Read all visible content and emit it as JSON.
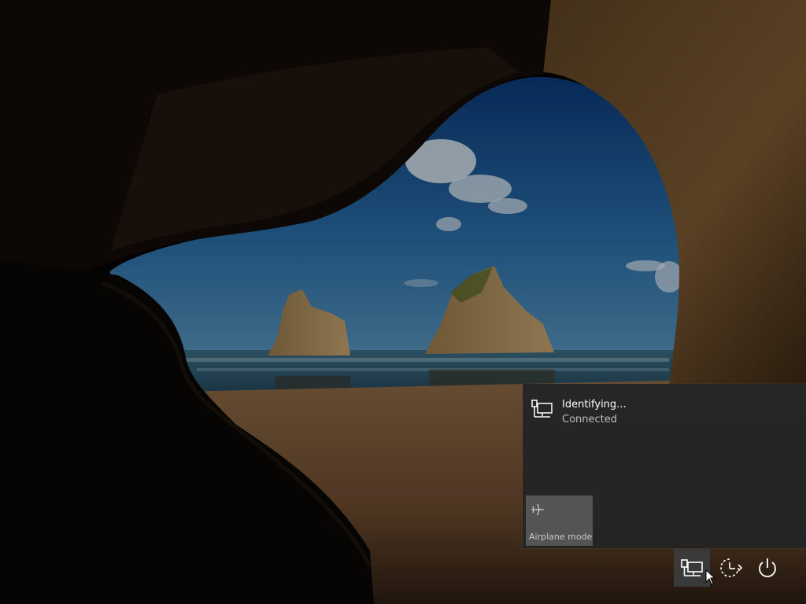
{
  "network": {
    "title": "Identifying...",
    "status": "Connected",
    "icon": "wired-network-icon"
  },
  "quick_action": {
    "label": "Airplane mode",
    "icon": "airplane-icon",
    "state": "off"
  },
  "system_buttons": [
    {
      "icon": "network-icon"
    },
    {
      "icon": "ease-of-access-icon"
    },
    {
      "icon": "power-icon"
    }
  ],
  "colors": {
    "flyout_bg": "#242424",
    "tile_bg": "#545454",
    "text_primary": "#ffffff",
    "text_secondary": "#bdbdbd"
  }
}
